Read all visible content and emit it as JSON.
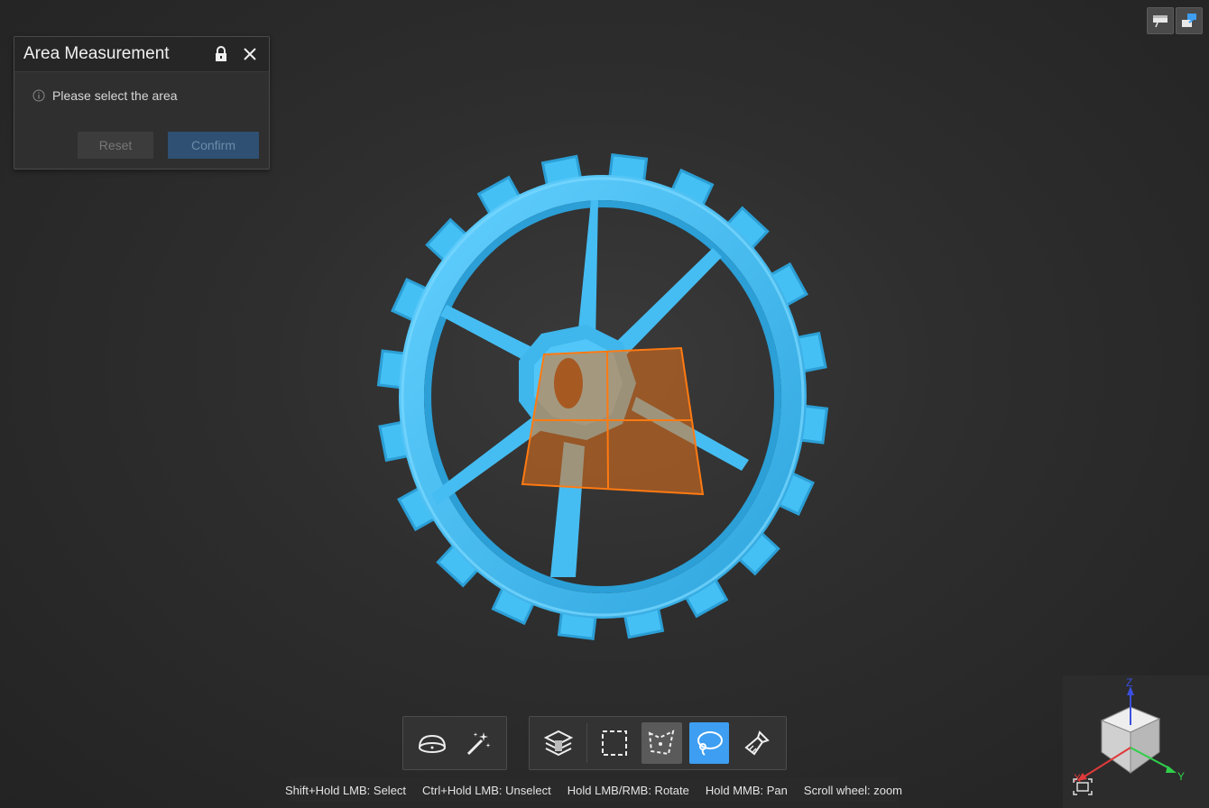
{
  "panel": {
    "title": "Area Measurement",
    "info_text": "Please select the area",
    "reset_label": "Reset",
    "confirm_label": "Confirm"
  },
  "hints": [
    "Shift+Hold LMB: Select",
    "Ctrl+Hold LMB: Unselect",
    "Hold LMB/RMB: Rotate",
    "Hold MMB: Pan",
    "Scroll wheel: zoom"
  ],
  "toolbar_left": [
    {
      "icon": "dome-select-icon",
      "state": "normal"
    },
    {
      "icon": "magic-wand-icon",
      "state": "normal"
    }
  ],
  "toolbar_right": [
    {
      "icon": "layer-through-icon",
      "state": "normal"
    },
    {
      "icon": "rectangle-select-icon",
      "state": "normal"
    },
    {
      "icon": "polygon-select-icon",
      "state": "pressed"
    },
    {
      "icon": "lasso-select-icon",
      "state": "active"
    },
    {
      "icon": "brush-select-icon",
      "state": "normal"
    }
  ],
  "navcube": {
    "axis_x": "X",
    "axis_y": "Y",
    "axis_z": "Z"
  },
  "colors": {
    "model": "#45c0f5",
    "selection": "#e8731c",
    "active_tool": "#3d9ef2",
    "confirm_button": "#2f5073"
  }
}
